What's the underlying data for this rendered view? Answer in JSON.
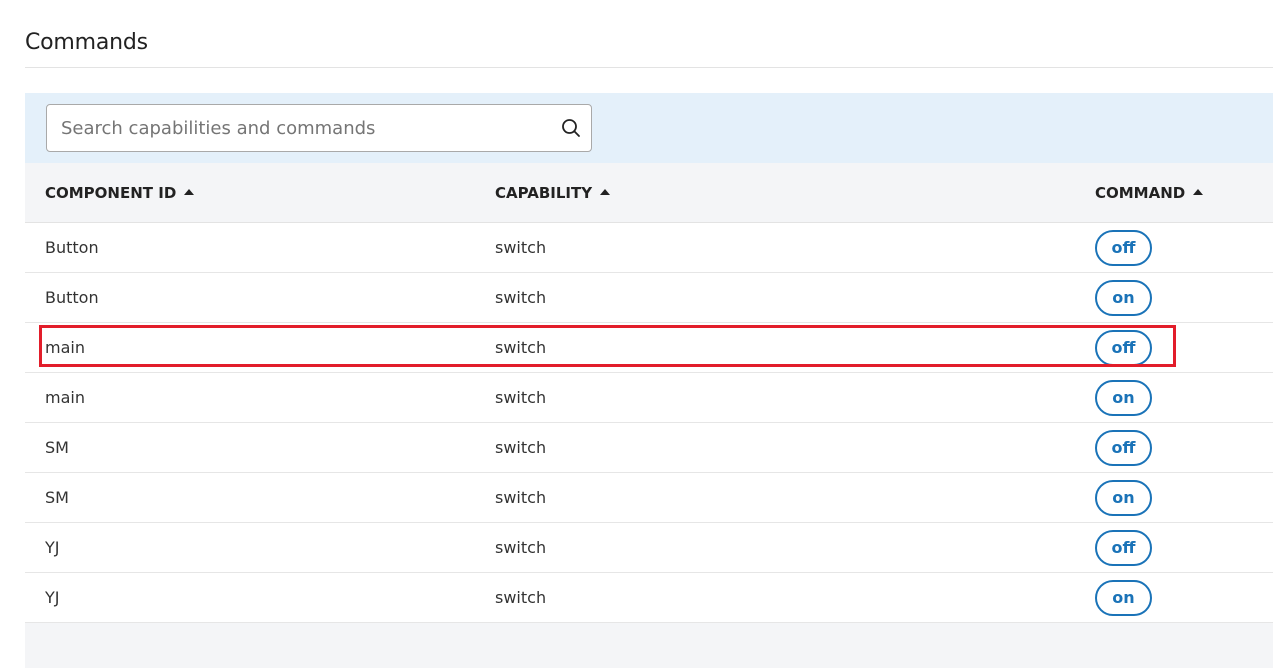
{
  "page": {
    "title": "Commands"
  },
  "search": {
    "placeholder": "Search capabilities and commands",
    "value": ""
  },
  "table": {
    "columns": [
      {
        "label": "COMPONENT ID",
        "sort": "ascending"
      },
      {
        "label": "CAPABILITY",
        "sort": "ascending"
      },
      {
        "label": "COMMAND",
        "sort": "ascending"
      }
    ],
    "rows": [
      {
        "component": "Button",
        "capability": "switch",
        "command": "off"
      },
      {
        "component": "Button",
        "capability": "switch",
        "command": "on"
      },
      {
        "component": "main",
        "capability": "switch",
        "command": "off"
      },
      {
        "component": "main",
        "capability": "switch",
        "command": "on"
      },
      {
        "component": "SM",
        "capability": "switch",
        "command": "off"
      },
      {
        "component": "SM",
        "capability": "switch",
        "command": "on"
      },
      {
        "component": "YJ",
        "capability": "switch",
        "command": "off"
      },
      {
        "component": "YJ",
        "capability": "switch",
        "command": "on"
      }
    ],
    "highlighted_row": 2
  },
  "colors": {
    "accent": "#1a73b8",
    "search_area_bg": "#e4f0fa",
    "header_bg": "#f4f5f7",
    "highlight": "#e21d2a"
  },
  "icons": {
    "search": "search-icon",
    "sort": "sort-ascending-icon"
  }
}
